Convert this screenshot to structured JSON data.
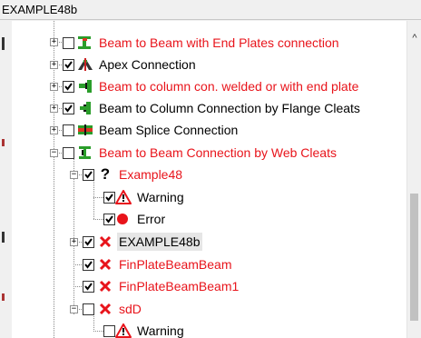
{
  "window": {
    "title": "EXAMPLE48b"
  },
  "tree": {
    "items": [
      {
        "label": "Beam to Beam with End Plates connection",
        "color": "red",
        "checked": false,
        "icon": "beam-end-plate-icon"
      },
      {
        "label": "Apex Connection",
        "color": "black",
        "checked": true,
        "icon": "apex-connection-icon"
      },
      {
        "label": "Beam to column con. welded or with end plate",
        "color": "red",
        "checked": true,
        "icon": "beam-column-welded-icon"
      },
      {
        "label": "Beam to Column Connection by Flange Cleats",
        "color": "black",
        "checked": true,
        "icon": "flange-cleat-icon"
      },
      {
        "label": "Beam Splice Connection",
        "color": "black",
        "checked": false,
        "icon": "beam-splice-icon"
      },
      {
        "label": "Beam to Beam Connection by Web Cleats",
        "color": "red",
        "checked": false,
        "icon": "web-cleat-icon"
      },
      {
        "label": "Example48",
        "color": "red",
        "checked": true,
        "icon": "question-icon"
      },
      {
        "label": "Warning",
        "color": "black",
        "checked": true,
        "icon": "warning-icon"
      },
      {
        "label": "Error",
        "color": "black",
        "checked": true,
        "icon": "error-icon"
      },
      {
        "label": "EXAMPLE48b",
        "color": "black",
        "checked": true,
        "icon": "cross-icon",
        "selected": true
      },
      {
        "label": "FinPlateBeamBeam",
        "color": "red",
        "checked": true,
        "icon": "cross-icon"
      },
      {
        "label": "FinPlateBeamBeam1",
        "color": "red",
        "checked": true,
        "icon": "cross-icon"
      },
      {
        "label": "sdD",
        "color": "red",
        "checked": false,
        "icon": "cross-icon"
      },
      {
        "label": "Warning",
        "color": "black",
        "checked": false,
        "icon": "warning-icon"
      }
    ]
  },
  "colors": {
    "red_text": "#e8141b",
    "selection": "#e6e6e6",
    "check": "#000000"
  }
}
